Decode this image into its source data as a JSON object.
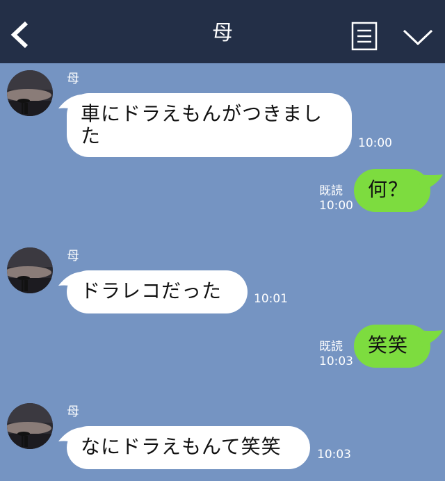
{
  "header": {
    "title": "母",
    "back_icon": "chevron-left-icon",
    "menu_icon": "list-icon",
    "more_icon": "chevron-down-icon"
  },
  "messages": [
    {
      "sender": "母",
      "text": "車にドラえもんがつきました",
      "time": "10:00"
    },
    {
      "text": "何？",
      "read": "既読",
      "time": "10:00"
    },
    {
      "sender": "母",
      "text": "ドラレコだった",
      "time": "10:01"
    },
    {
      "text": "笑笑",
      "read": "既読",
      "time": "10:03"
    },
    {
      "sender": "母",
      "text": "なにドラえもんて笑笑",
      "time": "10:03"
    }
  ],
  "colors": {
    "header_bg": "#232f47",
    "chat_bg": "#7594c2",
    "incoming_bubble": "#ffffff",
    "outgoing_bubble": "#7ddc3f"
  }
}
